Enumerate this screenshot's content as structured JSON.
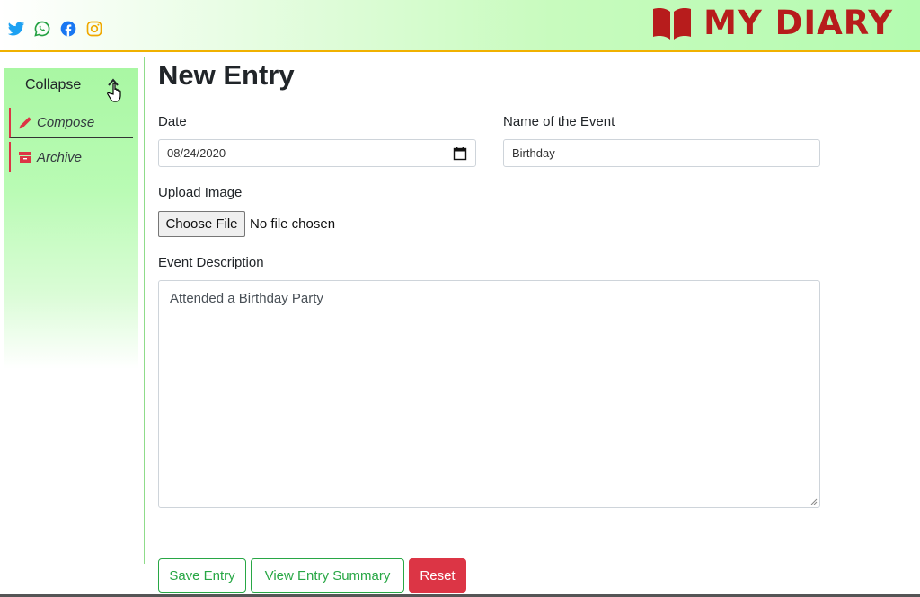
{
  "header": {
    "social": [
      "twitter-icon",
      "whatsapp-icon",
      "facebook-icon",
      "instagram-icon"
    ],
    "brand_title": "MY DIARY",
    "brand_icon": "open-book-icon",
    "colors": {
      "brand": "#b71c1c",
      "header_border": "#f0b100"
    }
  },
  "sidebar": {
    "collapse_label": "Collapse",
    "items": [
      {
        "label": "Compose",
        "icon": "pencil-icon"
      },
      {
        "label": "Archive",
        "icon": "archive-box-icon"
      }
    ]
  },
  "main": {
    "title": "New Entry",
    "date": {
      "label": "Date",
      "value": "08/24/2020"
    },
    "event_name": {
      "label": "Name of the Event",
      "value": "Birthday"
    },
    "upload": {
      "label": "Upload Image",
      "button": "Choose File",
      "status": "No file chosen"
    },
    "description": {
      "label": "Event Description",
      "value": "Attended a Birthday Party"
    }
  },
  "actions": {
    "save": "Save Entry",
    "view_summary": "View Entry Summary",
    "reset": "Reset",
    "colors": {
      "success": "#28a745",
      "danger": "#dc3545"
    }
  }
}
